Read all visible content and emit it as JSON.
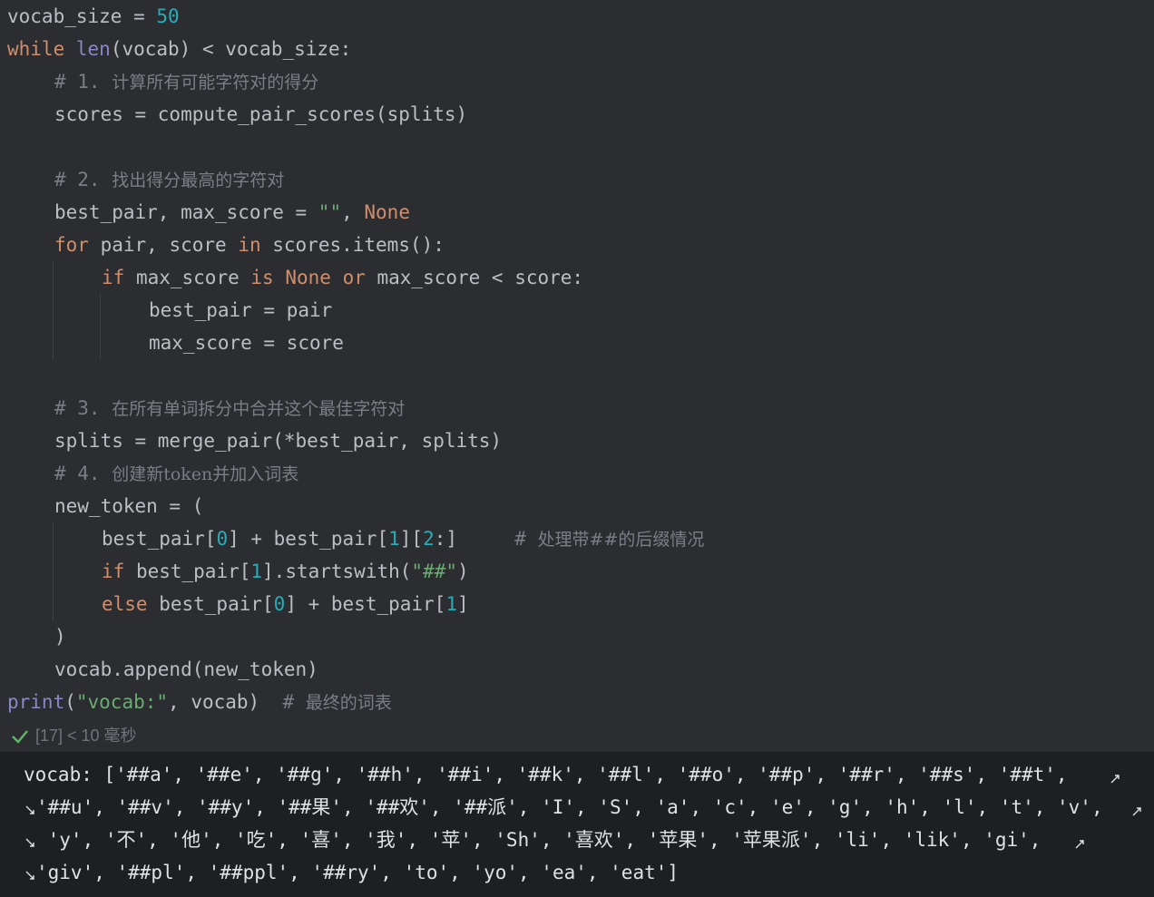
{
  "code": {
    "l1": {
      "a": "vocab_size = ",
      "b": "50"
    },
    "l2": {
      "a": "while",
      "b": " ",
      "c": "len",
      "d": "(vocab) < vocab_size:"
    },
    "l3": {
      "a": "# 1. ",
      "b": "计算所有可能字符对的得分"
    },
    "l4": {
      "a": "scores = compute_pair_scores(splits)"
    },
    "l6": {
      "a": "# 2. ",
      "b": "找出得分最高的字符对"
    },
    "l7": {
      "a": "best_pair, max_score = ",
      "b": "\"\"",
      "c": ", ",
      "d": "None"
    },
    "l8": {
      "a": "for",
      "b": " pair, score ",
      "c": "in",
      "d": " scores.items():"
    },
    "l9": {
      "a": "if",
      "b": " max_score ",
      "c": "is",
      "d": " ",
      "e": "None",
      "f": " ",
      "g": "or",
      "h": " max_score < score:"
    },
    "l10": {
      "a": "best_pair = pair"
    },
    "l11": {
      "a": "max_score = score"
    },
    "l13": {
      "a": "# 3. ",
      "b": "在所有单词拆分中合并这个最佳字符对"
    },
    "l14": {
      "a": "splits = merge_pair(*best_pair, splits)"
    },
    "l15": {
      "a": "# 4. ",
      "b": "创建新token并加入词表"
    },
    "l16": {
      "a": "new_token = ("
    },
    "l17": {
      "a": "best_pair[",
      "b": "0",
      "c": "] + best_pair[",
      "d": "1",
      "e": "][",
      "f": "2",
      "g": ":]",
      "h": "     # ",
      "i": "处理带##的后缀情况"
    },
    "l18": {
      "a": "if",
      "b": " best_pair[",
      "c": "1",
      "d": "].startswith(",
      "e": "\"##\"",
      "f": ")"
    },
    "l19": {
      "a": "else",
      "b": " best_pair[",
      "c": "0",
      "d": "] + best_pair[",
      "e": "1",
      "f": "]"
    },
    "l20": {
      "a": ")"
    },
    "l21": {
      "a": "vocab.append(new_token)"
    },
    "l22": {
      "a": "print",
      "b": "(",
      "c": "\"vocab:\"",
      "d": ", vocab)  ",
      "e": "# ",
      "f": "最终的词表"
    }
  },
  "status": {
    "icon": "check-icon",
    "text": "[17] < 10 毫秒"
  },
  "output": {
    "lines": [
      "vocab: ['##a', '##e', '##g', '##h', '##i', '##k', '##l', '##o', '##p', '##r', '##s', '##t',",
      "'##u', '##v', '##y', '##果', '##欢', '##派', 'I', 'S', 'a', 'c', 'e', 'g', 'h', 'l', 't', 'v',",
      " 'y', '不', '他', '吃', '喜', '我', '苹', 'Sh', '喜欢', '苹果', '苹果派', 'li', 'lik', 'gi',",
      "'giv', '##pl', '##ppl', '##ry', 'to', 'yo', 'ea', 'eat']"
    ],
    "wrap_icon": "soft-wrap-icon"
  },
  "colors": {
    "background": "#2b2d30",
    "output_bg": "#1e1f22",
    "keyword": "#cf8e6d",
    "number": "#2aacb8",
    "string": "#6aab73",
    "comment": "#7a7e85",
    "builtin": "#8888c6"
  }
}
